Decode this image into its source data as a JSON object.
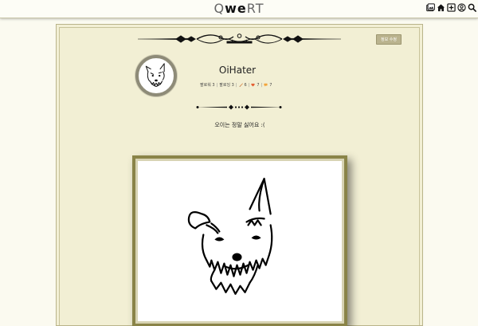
{
  "brand": {
    "part1": "Q",
    "part2": "we",
    "part3": "RT"
  },
  "nav": {
    "icons": [
      "gallery-icon",
      "home-icon",
      "add-icon",
      "profile-icon",
      "search-icon"
    ]
  },
  "profile": {
    "info_button": "정보 수정",
    "username": "OiHater",
    "followers": "팔로워 3",
    "following": "팔로잉 3",
    "drawings_count": "6",
    "likes_count": "7",
    "comments_count": "7",
    "bio": "오이는 정말 싫어요 :("
  },
  "colors": {
    "panel_bg": "#f2efd4",
    "frame_gold": "#8a8448",
    "info_button_bg": "#bab38e"
  }
}
